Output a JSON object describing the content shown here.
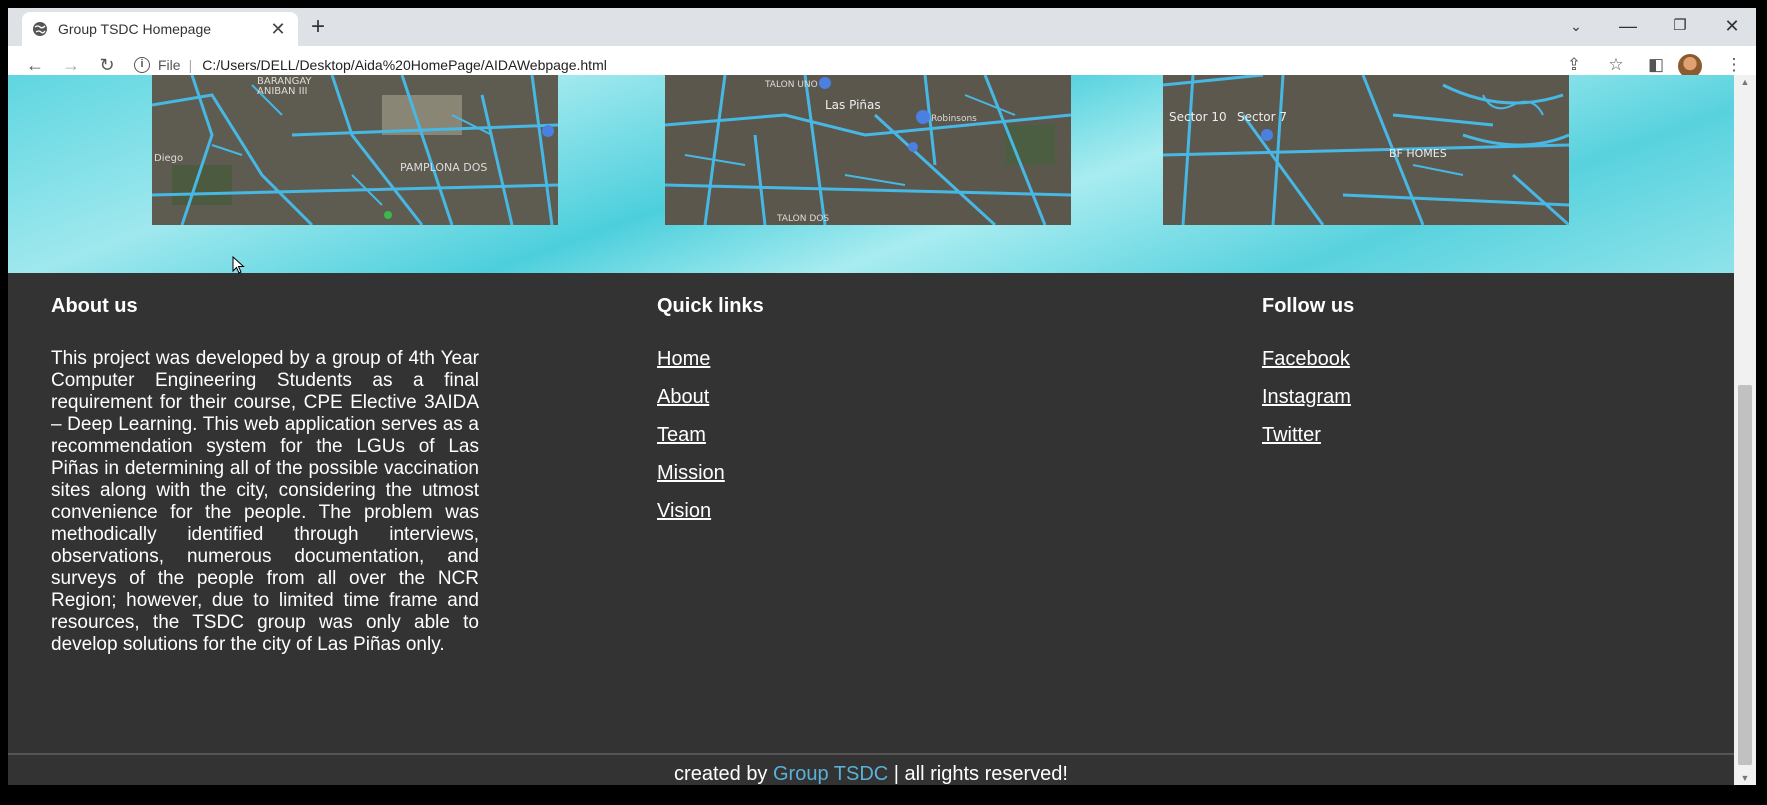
{
  "browser": {
    "tab_title": "Group TSDC Homepage",
    "scheme_label": "File",
    "url": "C:/Users/DELL/Desktop/Aida%20HomePage/AIDAWebpage.html"
  },
  "maps": [
    {
      "labels": [
        "BARANGAY",
        "ANIBAN III",
        "PAMPLONA DOS",
        "Diego"
      ]
    },
    {
      "labels": [
        "TALON UNO",
        "Las Piñas",
        "Robinsons",
        "TALON DOS"
      ]
    },
    {
      "labels": [
        "Sector 10",
        "Sector 7",
        "BF HOMES"
      ]
    }
  ],
  "footer": {
    "about": {
      "heading": "About us",
      "text": "This project was developed by a group of 4th Year Computer Engineering Students as a final requirement for their course, CPE Elective 3AIDA – Deep Learning. This web application serves as a recommendation system for the LGUs of Las Piñas in determining all of the possible vaccination sites along with the city, considering the utmost convenience for the people. The problem was methodically identified through interviews, observations, numerous documentation, and surveys of the people from all over the NCR Region; however, due to limited time frame and resources, the TSDC group was only able to develop solutions for the city of Las Piñas only."
    },
    "quick_links": {
      "heading": "Quick links",
      "items": [
        "Home",
        "About",
        "Team",
        "Mission",
        "Vision"
      ]
    },
    "follow": {
      "heading": "Follow us",
      "items": [
        "Facebook",
        "Instagram",
        "Twitter"
      ]
    },
    "credits": {
      "prefix": "created by ",
      "brand": "Group TSDC",
      "suffix": " | all rights reserved!"
    }
  }
}
